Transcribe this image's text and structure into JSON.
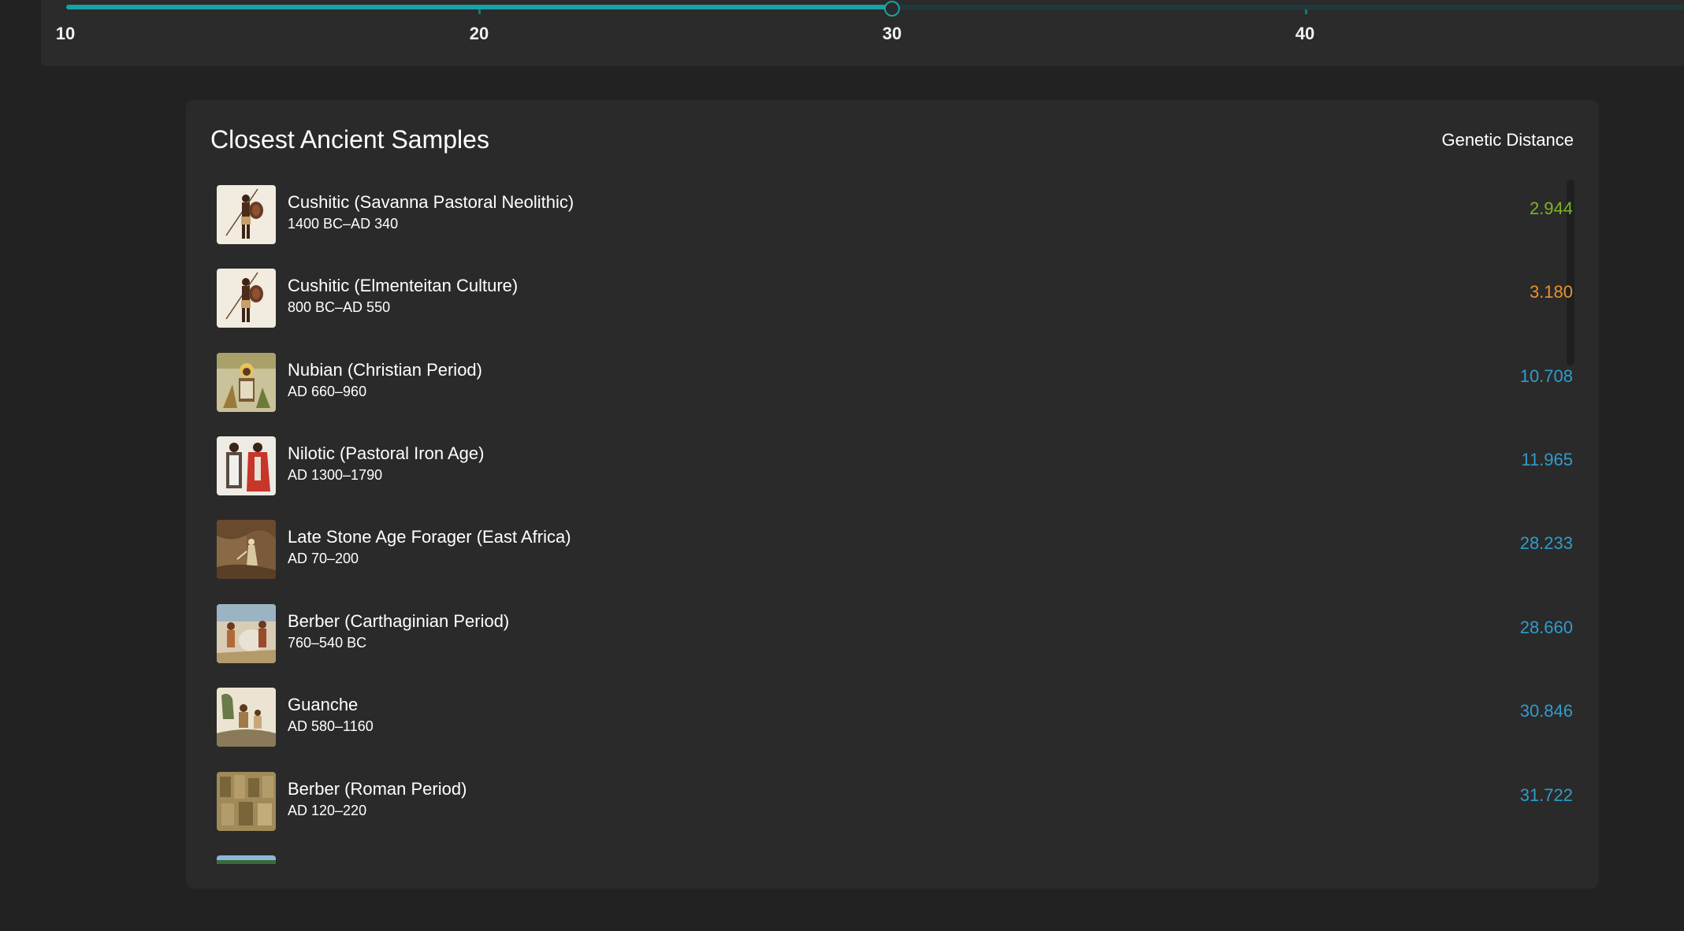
{
  "slider": {
    "value": 30,
    "min": 10,
    "max": 50,
    "ticks": [
      "10",
      "20",
      "30",
      "40"
    ],
    "accent_color": "#17a3a6"
  },
  "card": {
    "title": "Closest Ancient Samples",
    "column_header": "Genetic Distance"
  },
  "samples": [
    {
      "name": "Cushitic (Savanna Pastoral Neolithic)",
      "dates": "1400 BC–AD 340",
      "distance": "2.944",
      "distance_color": "#7fb327",
      "image": "warrior-figure-illustration"
    },
    {
      "name": "Cushitic (Elmenteitan Culture)",
      "dates": "800 BC–AD 550",
      "distance": "3.180",
      "distance_color": "#e8922c",
      "image": "warrior-figure-illustration"
    },
    {
      "name": "Nubian (Christian Period)",
      "dates": "AD 660–960",
      "distance": "10.708",
      "distance_color": "#2f9ccc",
      "image": "nubian-fresco-painting"
    },
    {
      "name": "Nilotic (Pastoral Iron Age)",
      "dates": "AD 1300–1790",
      "distance": "11.965",
      "distance_color": "#2f9ccc",
      "image": "nilotic-figures-illustration"
    },
    {
      "name": "Late Stone Age Forager (East Africa)",
      "dates": "AD 70–200",
      "distance": "28.233",
      "distance_color": "#2f9ccc",
      "image": "rock-art-painting"
    },
    {
      "name": "Berber (Carthaginian Period)",
      "dates": "760–540 BC",
      "distance": "28.660",
      "distance_color": "#2f9ccc",
      "image": "carthaginian-scene-illustration"
    },
    {
      "name": "Guanche",
      "dates": "AD 580–1160",
      "distance": "30.846",
      "distance_color": "#2f9ccc",
      "image": "guanche-scene-illustration"
    },
    {
      "name": "Berber (Roman Period)",
      "dates": "AD 120–220",
      "distance": "31.722",
      "distance_color": "#2f9ccc",
      "image": "roman-relief-carving"
    },
    {
      "name": "",
      "dates": "",
      "distance": "",
      "distance_color": "#2f9ccc",
      "image": "landscape-partial"
    }
  ]
}
